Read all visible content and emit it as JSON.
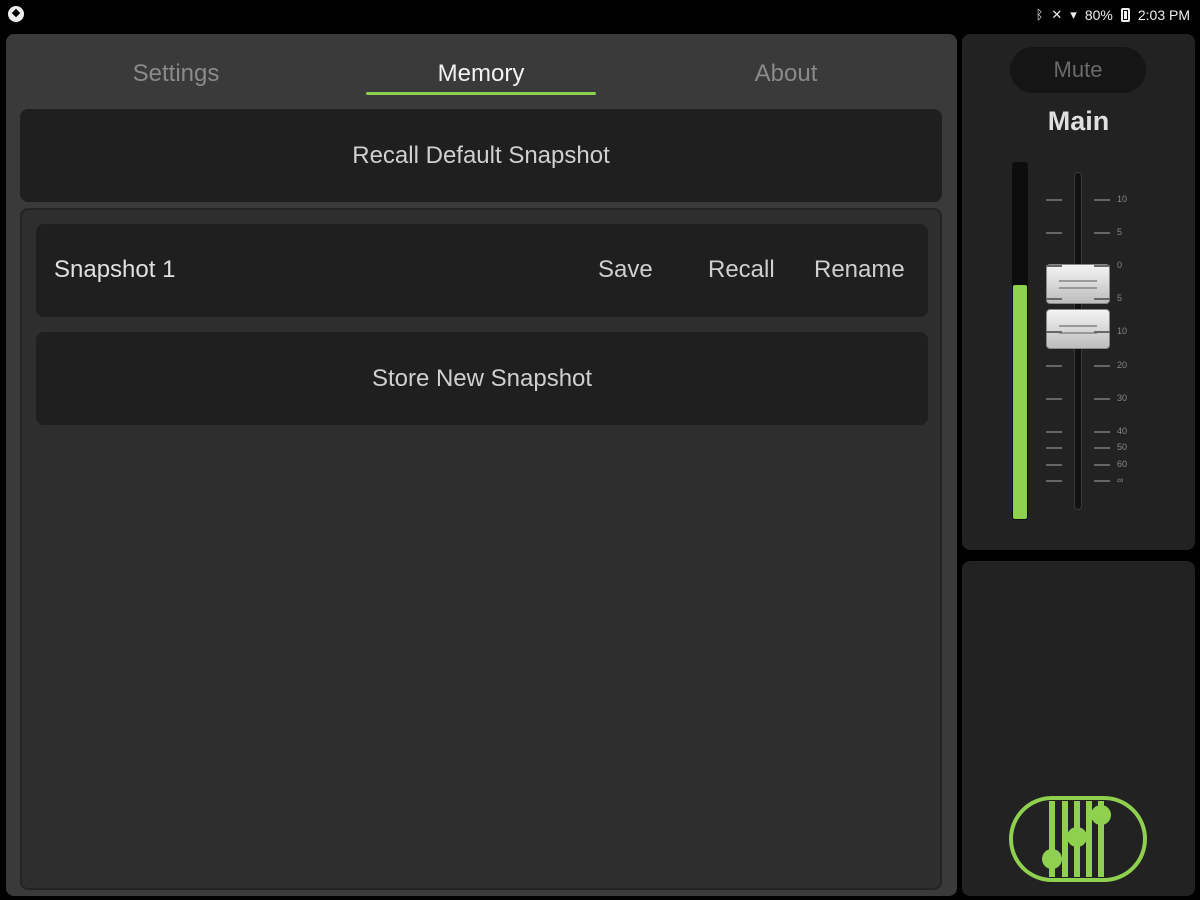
{
  "status_bar": {
    "battery": "80%",
    "time": "2:03 PM"
  },
  "tabs": [
    {
      "label": "Settings",
      "active": false
    },
    {
      "label": "Memory",
      "active": true
    },
    {
      "label": "About",
      "active": false
    }
  ],
  "memory": {
    "recall_default_label": "Recall Default Snapshot",
    "snapshots": [
      {
        "name": "Snapshot 1",
        "save": "Save",
        "recall": "Recall",
        "rename": "Rename"
      }
    ],
    "store_new_label": "Store New Snapshot"
  },
  "fader": {
    "mute_label": "Mute",
    "channel_label": "Main",
    "scale": [
      "10",
      "5",
      "0",
      "5",
      "10",
      "20",
      "30",
      "40",
      "50",
      "60",
      "∞"
    ],
    "meter_level": 0.66
  },
  "colors": {
    "accent": "#8fd14f",
    "panel": "#3a3a3a",
    "button": "#1f1f1f"
  }
}
